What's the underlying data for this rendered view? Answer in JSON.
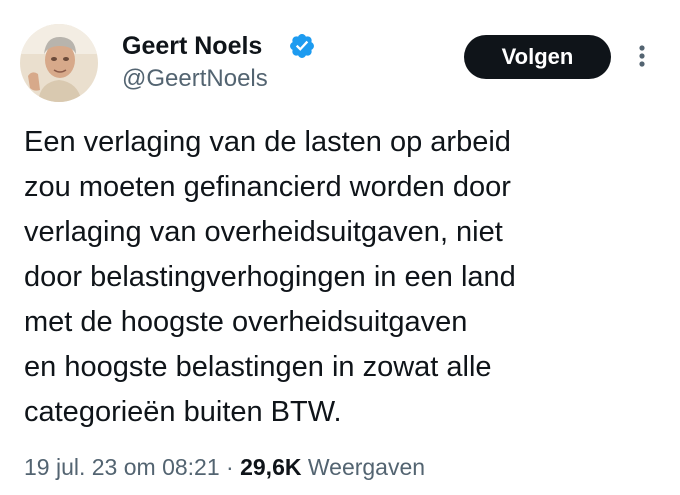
{
  "author": {
    "display_name": "Geert Noels",
    "handle": "@GeertNoels",
    "verified": true
  },
  "follow_button": {
    "label": "Volgen"
  },
  "tweet": {
    "text": "Een verlaging van de lasten op arbeid\nzou moeten gefinancierd worden door\nverlaging van overheidsuitgaven, niet\ndoor belastingverhogingen in een land\nmet de hoogste overheidsuitgaven\nen hoogste belastingen in zowat alle\ncategorieën buiten BTW."
  },
  "meta": {
    "timestamp": "19 jul. 23 om 08:21",
    "separator": "·",
    "views_count": "29,6K",
    "views_label": "Weergaven"
  },
  "icons": {
    "verified": "verified-badge-icon",
    "more": "more-options-icon"
  },
  "colors": {
    "verified_blue": "#1d9bf0",
    "text_primary": "#0f1419",
    "text_secondary": "#536471",
    "button_bg": "#0f1419"
  }
}
